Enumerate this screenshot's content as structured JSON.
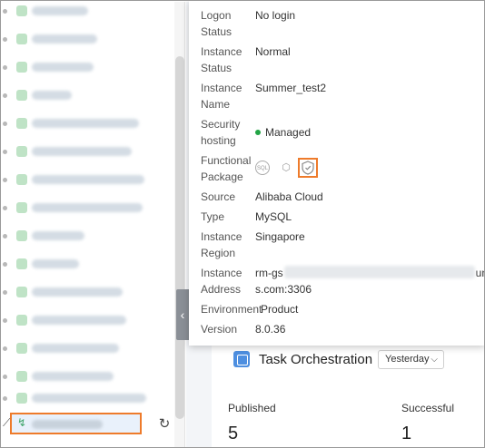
{
  "details": {
    "logon_status": {
      "label": "Logon Status",
      "value": "No login"
    },
    "instance_status": {
      "label": "Instance Status",
      "value": "Normal"
    },
    "instance_name": {
      "label": "Instance Name",
      "value": "Summer_test2"
    },
    "security_hosting": {
      "label": "Security hosting",
      "value": "Managed"
    },
    "functional_package": {
      "label": "Functional Package",
      "icons": [
        "sql-icon",
        "dpl-icon",
        "sensitive-data-shield-icon"
      ]
    },
    "source": {
      "label": "Source",
      "value": "Alibaba Cloud"
    },
    "type": {
      "label": "Type",
      "value": "MySQL"
    },
    "region": {
      "label": "Instance Region",
      "value": "Singapore"
    },
    "address": {
      "label": "Instance Address",
      "prefix": "rm-gs",
      "suffix": "un",
      "line2": "s.com:3306"
    },
    "environment": {
      "label": "Environment",
      "value": "Product"
    },
    "version": {
      "label": "Version",
      "value": "8.0.36"
    }
  },
  "task_orchestration": {
    "title": "Task Orchestration",
    "period": "Yesterday",
    "published_label": "Published",
    "published_value": "5",
    "successful_label": "Successful",
    "successful_value": "1"
  },
  "colors": {
    "highlight": "#ee7b2b",
    "managed_dot": "#22a445",
    "accent": "#4e8fe0"
  },
  "icons": {
    "refresh": "refresh-icon",
    "collapse": "chevron-left-icon"
  }
}
